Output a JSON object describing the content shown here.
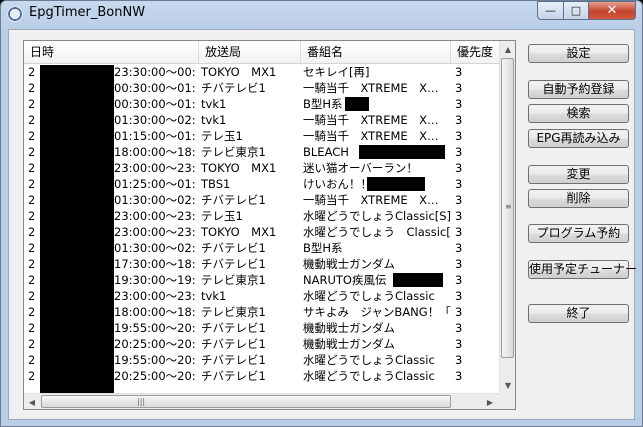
{
  "window": {
    "title": "EpgTimer_BonNW",
    "min_glyph": "—",
    "max_glyph": "□",
    "close_glyph": "✕"
  },
  "columns": {
    "date": "日時",
    "station": "放送局",
    "program": "番組名",
    "priority": "優先度"
  },
  "rows": [
    {
      "d1": "2",
      "d2": "23:30:00～00:0…",
      "station": "TOKYO　MX1",
      "program": "セキレイ[再]",
      "pri": "3"
    },
    {
      "d1": "2",
      "d2": "00:30:00～01:0…",
      "station": "チバテレビ1",
      "program": "一騎当千　XTREME　X…",
      "pri": "3"
    },
    {
      "d1": "2",
      "d2": "00:30:00～01:0…",
      "station": "tvk1",
      "program": "B型H系",
      "pri": "3"
    },
    {
      "d1": "2",
      "d2": "01:30:00～02:0…",
      "station": "tvk1",
      "program": "一騎当千　XTREME　X…",
      "pri": "3"
    },
    {
      "d1": "2",
      "d2": "01:15:00～01:4…",
      "station": "テレ玉1",
      "program": "一騎当千　XTREME　X…",
      "pri": "3"
    },
    {
      "d1": "2",
      "d2": "18:00:00～18:3…",
      "station": "テレビ東京1",
      "program": "BLEACH",
      "pri": "3"
    },
    {
      "d1": "2",
      "d2": "23:00:00～23:3…",
      "station": "TOKYO　MX1",
      "program": "迷い猫オーバーラン！",
      "pri": "3"
    },
    {
      "d1": "2",
      "d2": "01:25:00～01:5…",
      "station": "TBS1",
      "program": "けいおん！！",
      "pri": "3"
    },
    {
      "d1": "2",
      "d2": "01:30:00～02:0…",
      "station": "チバテレビ1",
      "program": "一騎当千　XTREME　X…",
      "pri": "3"
    },
    {
      "d1": "2",
      "d2": "23:00:00～23:3…",
      "station": "テレ玉1",
      "program": "水曜どうでしょうClassic[S]",
      "pri": "3"
    },
    {
      "d1": "2",
      "d2": "23:00:00～23:3…",
      "station": "TOKYO　MX1",
      "program": "水曜どうでしょう　Classic[…",
      "pri": "3"
    },
    {
      "d1": "2",
      "d2": "01:30:00～02:0…",
      "station": "チバテレビ1",
      "program": "B型H系",
      "pri": "3"
    },
    {
      "d1": "2",
      "d2": "17:30:00～18:0…",
      "station": "チバテレビ1",
      "program": "機動戦士ガンダム",
      "pri": "3"
    },
    {
      "d1": "2",
      "d2": "19:30:00～19:5…",
      "station": "テレビ東京1",
      "program": "NARUTO疾風伝",
      "pri": "3"
    },
    {
      "d1": "2",
      "d2": "23:00:00～23:3…",
      "station": "tvk1",
      "program": "水曜どうでしょうClassic",
      "pri": "3"
    },
    {
      "d1": "2",
      "d2": "18:00:00～18:3…",
      "station": "テレビ東京1",
      "program": "サキよみ　ジャンBANG！「…",
      "pri": "3"
    },
    {
      "d1": "2",
      "d2": "19:55:00～20:2…",
      "station": "チバテレビ1",
      "program": "機動戦士ガンダム",
      "pri": "3"
    },
    {
      "d1": "2",
      "d2": "20:25:00～20:5…",
      "station": "チバテレビ1",
      "program": "機動戦士ガンダム",
      "pri": "3"
    },
    {
      "d1": "2",
      "d2": "19:55:00～20:2…",
      "station": "チバテレビ1",
      "program": "水曜どうでしょうClassic",
      "pri": "3"
    },
    {
      "d1": "2",
      "d2": "20:25:00～20:5…",
      "station": "チバテレビ1",
      "program": "水曜どうでしょうClassic",
      "pri": "3"
    }
  ],
  "buttons": {
    "settings": "設定",
    "auto_reserve": "自動予約登録",
    "search": "検索",
    "epg_reload": "EPG再読み込み",
    "change": "変更",
    "delete": "削除",
    "program_reserve": "プログラム予約",
    "tuner": "使用予定チューナー",
    "exit": "終了"
  },
  "scrollbar": {
    "up": "▲",
    "down": "▼",
    "left": "◀",
    "right": "▶",
    "grip_v": "≡",
    "grip_h": "|||"
  }
}
